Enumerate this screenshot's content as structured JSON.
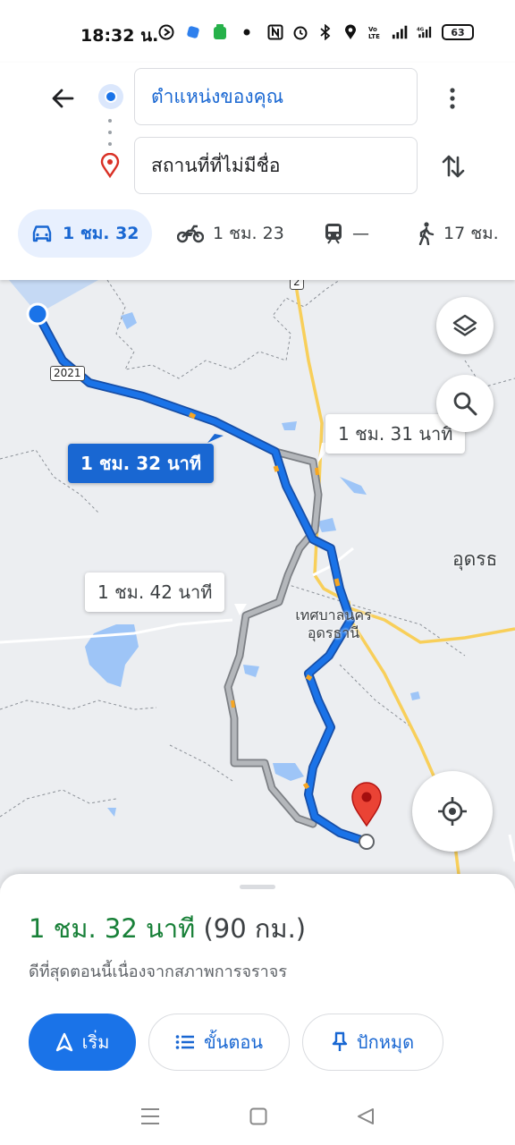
{
  "status_bar": {
    "time": "18:32 น.",
    "battery": "63"
  },
  "header": {
    "origin_text": "ตำแหน่งของคุณ",
    "destination_text": "สถานที่ที่ไม่มีชื่อ"
  },
  "modes": [
    {
      "label": "1 ชม. 32",
      "icon": "car-icon",
      "active": true
    },
    {
      "label": "1 ชม. 23",
      "icon": "motorcycle-icon",
      "active": false
    },
    {
      "label": "—",
      "icon": "train-icon",
      "active": false
    },
    {
      "label": "17 ชม.",
      "icon": "walk-icon",
      "active": false
    }
  ],
  "map": {
    "eta_main": "1 ชม. 32 นาที",
    "eta_alt_1": "1 ชม. 31 นาที",
    "eta_alt_2": "1 ชม. 42 นาที",
    "city_label_line1": "เทศบาลนคร",
    "city_label_line2": "อุดรธานี",
    "edge_label": "อุดรธ",
    "road_shield_1": "2021",
    "road_shield_2": "2",
    "colors": {
      "route_main": "#1a73e8",
      "route_alt": "#9e9e9e",
      "pin": "#d93025"
    }
  },
  "sheet": {
    "summary_time": "1 ชม. 32 นาที",
    "summary_distance": "(90 กม.)",
    "note": "ดีที่สุดตอนนี้เนื่องจากสภาพการจราจร",
    "start_label": "เริ่ม",
    "steps_label": "ขั้นตอน",
    "pin_label": "ปักหมุด"
  }
}
